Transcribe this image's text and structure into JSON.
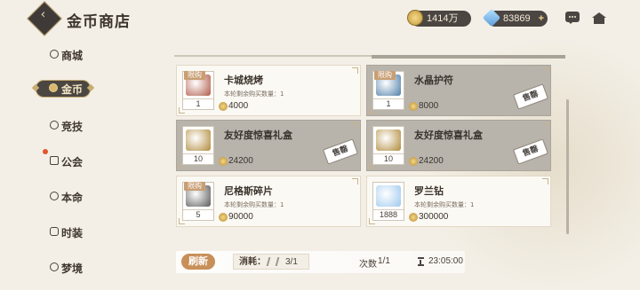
{
  "header": {
    "back_icon": "back-arrow-icon",
    "title": "金币商店",
    "gold_amount": "1414万",
    "diamond_amount": "83869",
    "plus": "+"
  },
  "sidebar": {
    "items": [
      {
        "label": "商城",
        "icon": "mall-icon",
        "active": false
      },
      {
        "label": "金币",
        "icon": "coin-icon",
        "active": true
      },
      {
        "label": "竞技",
        "icon": "swords-icon",
        "active": false
      },
      {
        "label": "公会",
        "icon": "guild-icon",
        "active": false,
        "badge": true
      },
      {
        "label": "本命",
        "icon": "destiny-icon",
        "active": false
      },
      {
        "label": "时装",
        "icon": "costume-icon",
        "active": false
      },
      {
        "label": "梦境",
        "icon": "dream-icon",
        "active": false
      }
    ]
  },
  "shop": {
    "items": [
      {
        "tag": "限购",
        "name": "卡城烧烤",
        "limit": "本轮剩余购买数量：1",
        "qty": "1",
        "price": "4000",
        "sold": false,
        "color": "#b15c4a"
      },
      {
        "tag": "限购",
        "name": "水晶护符",
        "limit": "",
        "qty": "1",
        "price": "8000",
        "sold": true,
        "stamp": "售罄",
        "color": "#4f7fa8"
      },
      {
        "tag": "",
        "name": "友好度惊喜礼盒",
        "limit": "",
        "qty": "10",
        "price": "24200",
        "sold": true,
        "stamp": "售罄",
        "color": "#b08a3a"
      },
      {
        "tag": "",
        "name": "友好度惊喜礼盒",
        "limit": "",
        "qty": "10",
        "price": "24200",
        "sold": true,
        "stamp": "售罄",
        "color": "#b08a3a"
      },
      {
        "tag": "限购",
        "name": "尼格斯碎片",
        "limit": "本轮剩余购买数量：1",
        "qty": "5",
        "price": "90000",
        "sold": false,
        "color": "#5c5a5a"
      },
      {
        "tag": "",
        "name": "罗兰钻",
        "limit": "本轮剩余购买数量：1",
        "qty": "1888",
        "price": "300000",
        "sold": false,
        "color": "#9ec9ee"
      }
    ]
  },
  "bottom": {
    "refresh_label": "刷新",
    "consume_label": "消耗：",
    "consume_value": "3/1",
    "times_label": "次数",
    "times_value": "1/1",
    "timer_value": "23:05:00"
  }
}
